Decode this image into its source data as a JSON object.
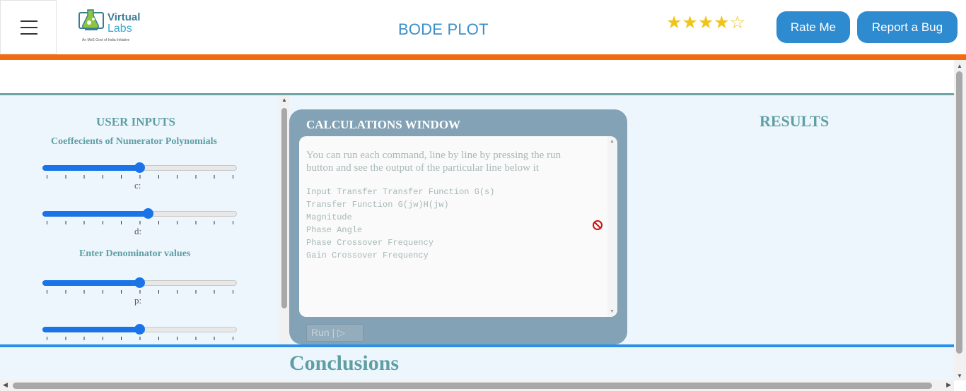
{
  "header": {
    "logo": {
      "word1": "Virtual",
      "word2": "Labs",
      "tagline": "An MoE Govt of India Initiative"
    },
    "title": "BODE PLOT",
    "rating": {
      "value": 4,
      "max": 5,
      "filled_stars": "★★★★",
      "empty_stars": "☆"
    },
    "rate_button": "Rate Me",
    "bug_button": "Report a Bug"
  },
  "user_inputs": {
    "title": "USER INPUTS",
    "numerator_heading": "Coeffecients of Numerator Polynomials",
    "denominator_heading": "Enter Denominator values",
    "sliders": [
      {
        "label": "c:",
        "fraction": 0.5
      },
      {
        "label": "d:",
        "fraction": 0.545
      },
      {
        "label": "p:",
        "fraction": 0.5
      },
      {
        "label": "",
        "fraction": 0.5
      }
    ]
  },
  "calculations": {
    "title": "CALCULATIONS WINDOW",
    "intro": "You can run each command, line by line by pressing the run button and see the output of the particular line below it",
    "lines": [
      "Input Transfer Transfer Function G(s)",
      "Transfer Function G(jw)H(jw)",
      "Magnitude",
      "Phase Angle",
      "Phase Crossover Frequency",
      "Gain Crossover Frequency"
    ],
    "run_button": "Run | ▷"
  },
  "results": {
    "title": "RESULTS"
  },
  "conclusions": {
    "title": "Conclusions"
  },
  "colors": {
    "accent_orange": "#f26a0f",
    "button_blue": "#2e8bcf",
    "heading_teal": "#5e9fa3",
    "slider_blue": "#1a74e8",
    "star_gold": "#f0c419"
  }
}
